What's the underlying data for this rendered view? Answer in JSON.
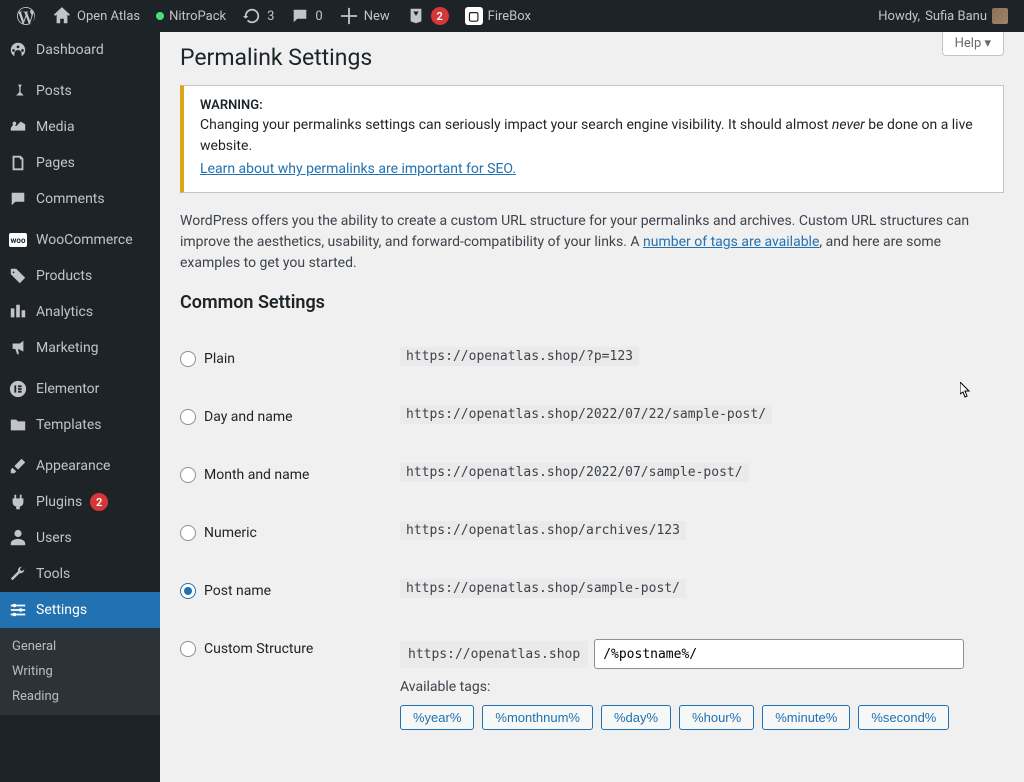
{
  "adminbar": {
    "site_title": "Open Atlas",
    "nitropack": "NitroPack",
    "updates_count": "3",
    "comments_count": "0",
    "new_label": "New",
    "yoast_count": "2",
    "firebox": "FireBox",
    "howdy_prefix": "Howdy, ",
    "user": "Sufia Banu"
  },
  "sidebar": {
    "dashboard": "Dashboard",
    "posts": "Posts",
    "media": "Media",
    "pages": "Pages",
    "comments": "Comments",
    "woocommerce": "WooCommerce",
    "products": "Products",
    "analytics": "Analytics",
    "marketing": "Marketing",
    "elementor": "Elementor",
    "templates": "Templates",
    "appearance": "Appearance",
    "plugins": "Plugins",
    "plugins_badge": "2",
    "users": "Users",
    "tools": "Tools",
    "settings": "Settings",
    "submenu": {
      "general": "General",
      "writing": "Writing",
      "reading": "Reading"
    }
  },
  "help": "Help",
  "page_title": "Permalink Settings",
  "notice": {
    "warning_label": "WARNING:",
    "text_a": "Changing your permalinks settings can seriously impact your search engine visibility. It should almost ",
    "never": "never",
    "text_b": " be done on a live website.",
    "link": "Learn about why permalinks are important for SEO."
  },
  "intro": {
    "text_a": "WordPress offers you the ability to create a custom URL structure for your permalinks and archives. Custom URL structures can improve the aesthetics, usability, and forward-compatibility of your links. A ",
    "link": "number of tags are available",
    "text_b": ", and here are some examples to get you started."
  },
  "common_settings": "Common Settings",
  "options": {
    "plain": {
      "label": "Plain",
      "code": "https://openatlas.shop/?p=123"
    },
    "dayname": {
      "label": "Day and name",
      "code": "https://openatlas.shop/2022/07/22/sample-post/"
    },
    "monthname": {
      "label": "Month and name",
      "code": "https://openatlas.shop/2022/07/sample-post/"
    },
    "numeric": {
      "label": "Numeric",
      "code": "https://openatlas.shop/archives/123"
    },
    "postname": {
      "label": "Post name",
      "code": "https://openatlas.shop/sample-post/"
    },
    "custom": {
      "label": "Custom Structure",
      "prefix": "https://openatlas.shop",
      "value": "/%postname%/"
    }
  },
  "available_tags_label": "Available tags:",
  "tags": [
    "%year%",
    "%monthnum%",
    "%day%",
    "%hour%",
    "%minute%",
    "%second%"
  ]
}
